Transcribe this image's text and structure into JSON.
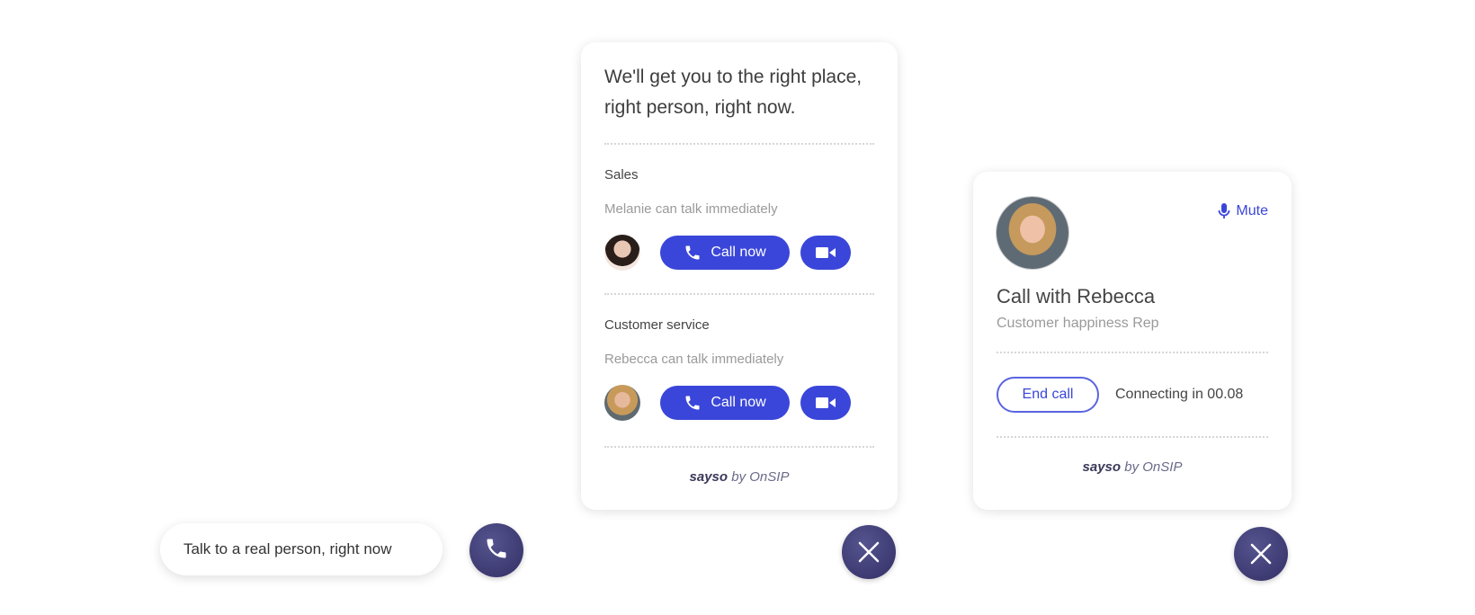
{
  "launcher": {
    "prompt_label": "Talk to a real person, right now",
    "icon": "phone-icon"
  },
  "menu_card": {
    "headline_line1": "We'll get you to the right place,",
    "headline_line2": "right person, right now.",
    "sections": [
      {
        "title": "Sales",
        "availability": "Melanie can talk immediately",
        "agent": "Melanie",
        "call_label": "Call now",
        "video_icon": "video-camera-icon"
      },
      {
        "title": "Customer service",
        "availability": "Rebecca can talk immediately",
        "agent": "Rebecca",
        "call_label": "Call now",
        "video_icon": "video-camera-icon"
      }
    ],
    "brand_name": "sayso",
    "brand_by": "by OnSIP",
    "close_icon": "close-icon"
  },
  "call_card": {
    "mute_label": "Mute",
    "title": "Call with Rebecca",
    "subtitle": "Customer happiness Rep",
    "end_call_label": "End call",
    "status": "Connecting in 00.08",
    "brand_name": "sayso",
    "brand_by": "by OnSIP",
    "close_icon": "close-icon"
  },
  "colors": {
    "accent": "#3a46d9",
    "fab": "#3b3770",
    "divider": "#d6d6d6"
  }
}
